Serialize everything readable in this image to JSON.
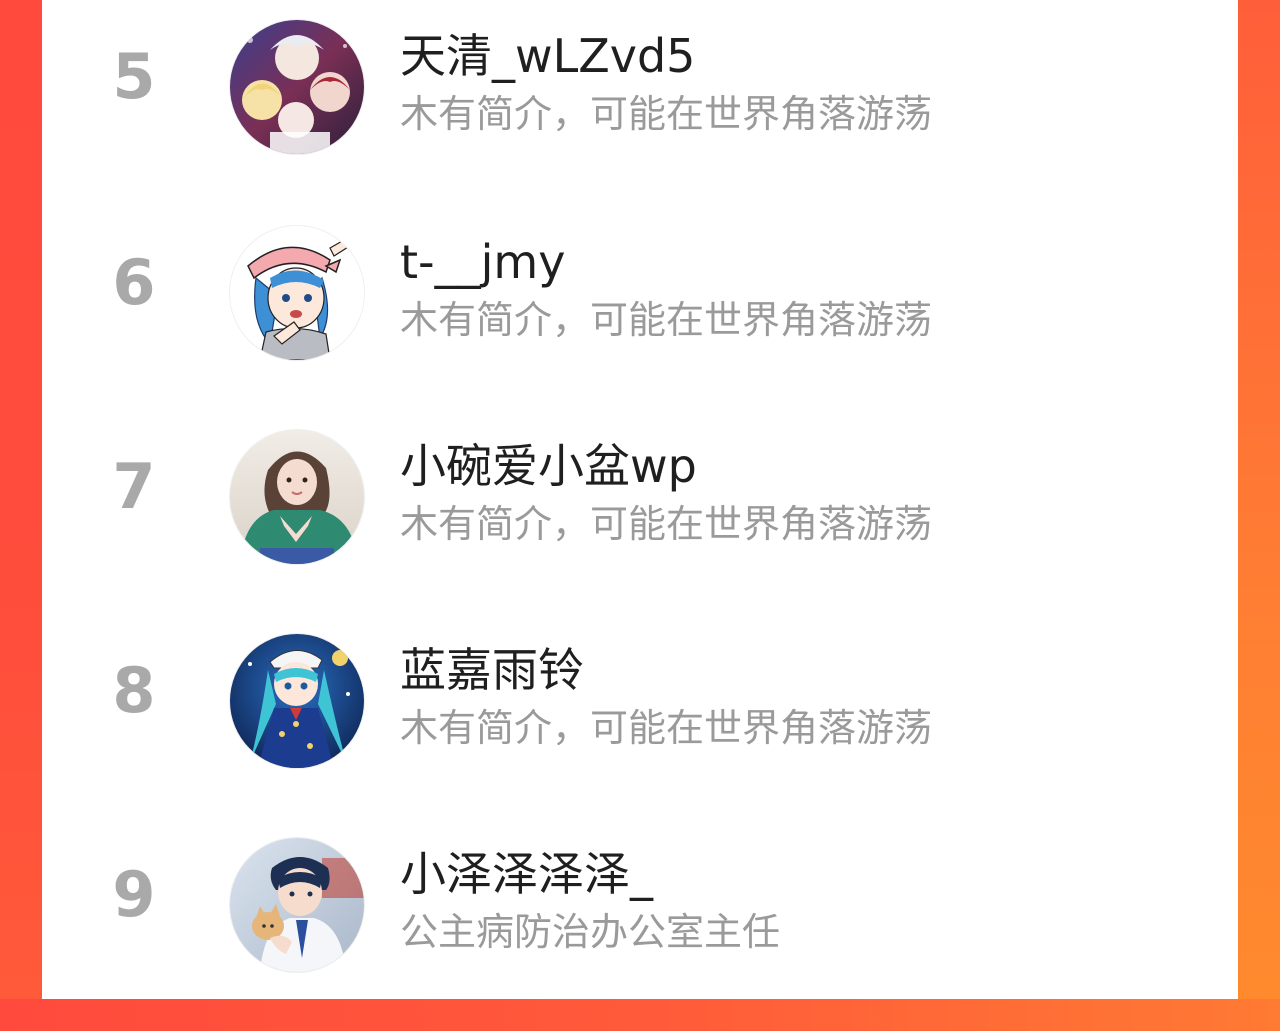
{
  "ranking": {
    "entries": [
      {
        "rank": "5",
        "name": "天清_wLZvd5",
        "bio": "木有简介，可能在世界角落游荡",
        "avatar_icon": "anime-group-avatar-icon"
      },
      {
        "rank": "6",
        "name": "t-__jmy",
        "bio": "木有简介，可能在世界角落游荡",
        "avatar_icon": "anime-girl-hat-avatar-icon"
      },
      {
        "rank": "7",
        "name": "小碗爱小盆wp",
        "bio": "木有简介，可能在世界角落游荡",
        "avatar_icon": "photo-girl-avatar-icon"
      },
      {
        "rank": "8",
        "name": "蓝嘉雨铃",
        "bio": "木有简介，可能在世界角落游荡",
        "avatar_icon": "anime-blue-hair-avatar-icon"
      },
      {
        "rank": "9",
        "name": "小泽泽泽泽_",
        "bio": "公主病防治办公室主任",
        "avatar_icon": "anime-boy-cat-avatar-icon"
      }
    ]
  },
  "colors": {
    "background_left": "#ff4a3d",
    "background_right": "#ff7a33",
    "rank_text": "#a9a9a9",
    "name_text": "#1f1f1f",
    "bio_text": "#9a9a9a"
  }
}
